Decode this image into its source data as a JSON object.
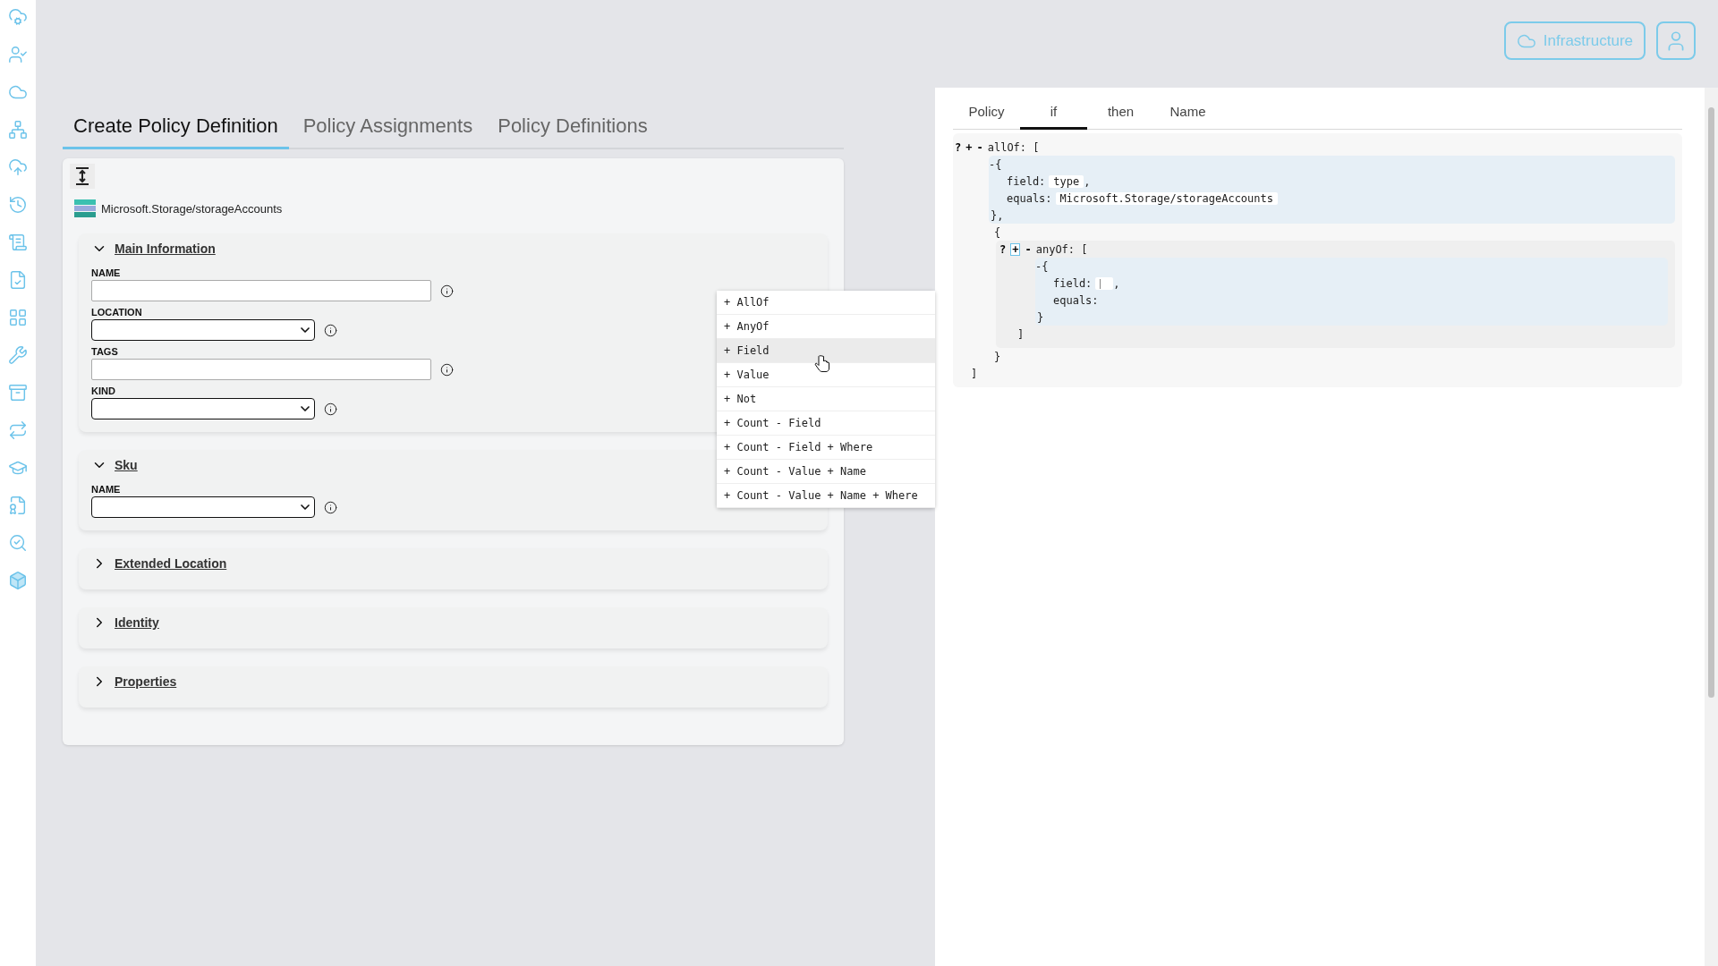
{
  "header": {
    "environment_button": "Infrastructure"
  },
  "tabs": [
    {
      "label": "Create Policy Definition",
      "selected": true
    },
    {
      "label": "Policy Assignments",
      "selected": false
    },
    {
      "label": "Policy Definitions",
      "selected": false
    }
  ],
  "resource": {
    "type": "Microsoft.Storage/storageAccounts"
  },
  "sections": [
    {
      "title": "Main Information",
      "expanded": true,
      "fields": [
        {
          "label": "NAME",
          "kind": "text"
        },
        {
          "label": "LOCATION",
          "kind": "select"
        },
        {
          "label": "TAGS",
          "kind": "text"
        },
        {
          "label": "KIND",
          "kind": "select"
        }
      ]
    },
    {
      "title": "Sku",
      "expanded": true,
      "fields": [
        {
          "label": "NAME",
          "kind": "select"
        }
      ]
    },
    {
      "title": "Extended Location",
      "expanded": false
    },
    {
      "title": "Identity",
      "expanded": false
    },
    {
      "title": "Properties",
      "expanded": false
    }
  ],
  "menu": {
    "items": [
      {
        "label": "+ AllOf",
        "highlighted": false
      },
      {
        "label": "+ AnyOf",
        "highlighted": false
      },
      {
        "label": "+ Field",
        "highlighted": true
      },
      {
        "label": "+ Value",
        "highlighted": false
      },
      {
        "label": "+ Not",
        "highlighted": false
      },
      {
        "label": "+ Count - Field",
        "highlighted": false
      },
      {
        "label": "+ Count - Field + Where",
        "highlighted": false
      },
      {
        "label": "+ Count - Value + Name",
        "highlighted": false
      },
      {
        "label": "+ Count - Value + Name + Where",
        "highlighted": false
      }
    ]
  },
  "editor_tabs": [
    {
      "label": "Policy",
      "selected": false
    },
    {
      "label": "if",
      "selected": true
    },
    {
      "label": "then",
      "selected": false
    },
    {
      "label": "Name",
      "selected": false
    }
  ],
  "editor": {
    "controls": [
      {
        "label": "?",
        "boxed": false
      },
      {
        "label": "+",
        "boxed": false
      },
      {
        "label": "-",
        "boxed": false
      }
    ],
    "key": "allOf:",
    "bracket_open": "[",
    "bracket_close": "]",
    "items": [
      {
        "kind": "condition",
        "open": "-{",
        "close": "},",
        "fields": [
          {
            "key": "field:",
            "value": "type",
            "suffix": ",",
            "focused": false
          },
          {
            "key": "equals:",
            "value": "Microsoft.Storage/storageAccounts",
            "focused": false
          }
        ]
      },
      {
        "kind": "group",
        "open": "{",
        "close": "}",
        "controls": [
          {
            "label": "?",
            "boxed": false
          },
          {
            "label": "+",
            "boxed": true
          },
          {
            "label": "-",
            "boxed": false
          }
        ],
        "key": "anyOf:",
        "bracket_open": "[",
        "bracket_close": "]",
        "items": [
          {
            "kind": "condition",
            "open": "-{",
            "close": "}",
            "fields": [
              {
                "key": "field:",
                "suffix": ",",
                "focused": true
              },
              {
                "key": "equals:",
                "focused": false
              }
            ]
          }
        ]
      }
    ]
  }
}
